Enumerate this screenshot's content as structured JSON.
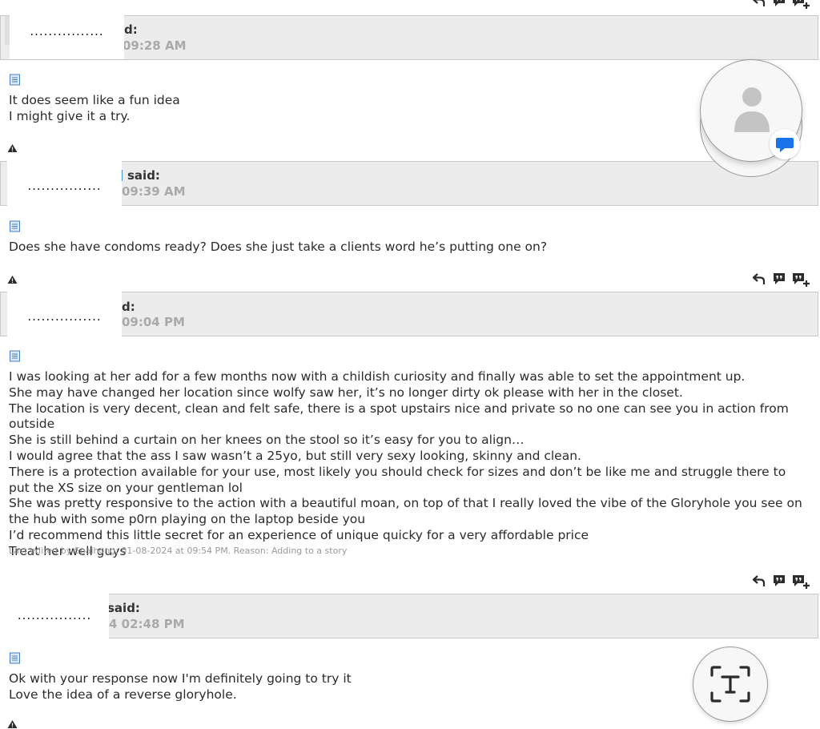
{
  "posts": [
    {
      "said": "d:",
      "time": "09:28 AM",
      "redacted": "................",
      "body": "It does seem like a fun idea\nI might give it a try.",
      "edit_note": ""
    },
    {
      "said": "said:",
      "time": "09:39 AM",
      "redacted": "................",
      "body": "Does she have condoms ready? Does she just take a clients word he’s putting one on?",
      "edit_note": ""
    },
    {
      "said": "d:",
      "time": "09:04 PM",
      "redacted": "................",
      "body": "I was looking at her add for a few months now with a childish curiosity and finally was able to set the appointment up.\nShe may have changed her location since wolfy saw her, it’s no longer dirty ok please with her in the closet.\nThe location is very decent, clean and felt safe, there is a spot upstairs nice and private so no one can see you in action from outside\nShe is still behind a curtain on her knees on the stool so it’s easy for you to align…\nI would agree that the ass I saw wasn’t a 25yo, but still very sexy looking, skinny and clean.\nThere is a protection available for your use, most likely you should check for sizes and don’t be like me and struggle there to put the XS size on your gentleman lol\nShe was pretty responsive to the action with a beautiful moan, on top of that I really loved the vibe of the Gloryhole you see on the hub with some p0rn playing on the laptop beside you\nI’d recommend this little secret for an experience of unique quicky for a very affordable price\nTreat her well guys",
      "edit_note": "Last edited by Spaihong; 01-08-2024 at 09:54 PM. Reason: Adding to a story"
    },
    {
      "said": "said:",
      "time": "4 02:48 PM",
      "redacted": "................",
      "body": "Ok with your response now I'm definitely going to try it\nLove the idea of a reverse gloryhole.",
      "edit_note": ""
    }
  ],
  "icons": {
    "post_icon": "document-icon",
    "report_icon": "warning-triangle-icon",
    "reply_icon": "reply-arrow-icon",
    "quote_icon": "quote-bubble-icon",
    "multiquote_icon": "multi-quote-plus-icon",
    "profile_fab_icon": "person-icon",
    "chat_badge_icon": "chat-bubble-icon",
    "text_scan_icon": "text-scan-icon"
  },
  "colors": {
    "header_bg": "#ececec",
    "time_text": "#a9a9a9",
    "doc_icon_blue": "#4a7fc1",
    "chat_badge_blue": "#1a73e8"
  }
}
